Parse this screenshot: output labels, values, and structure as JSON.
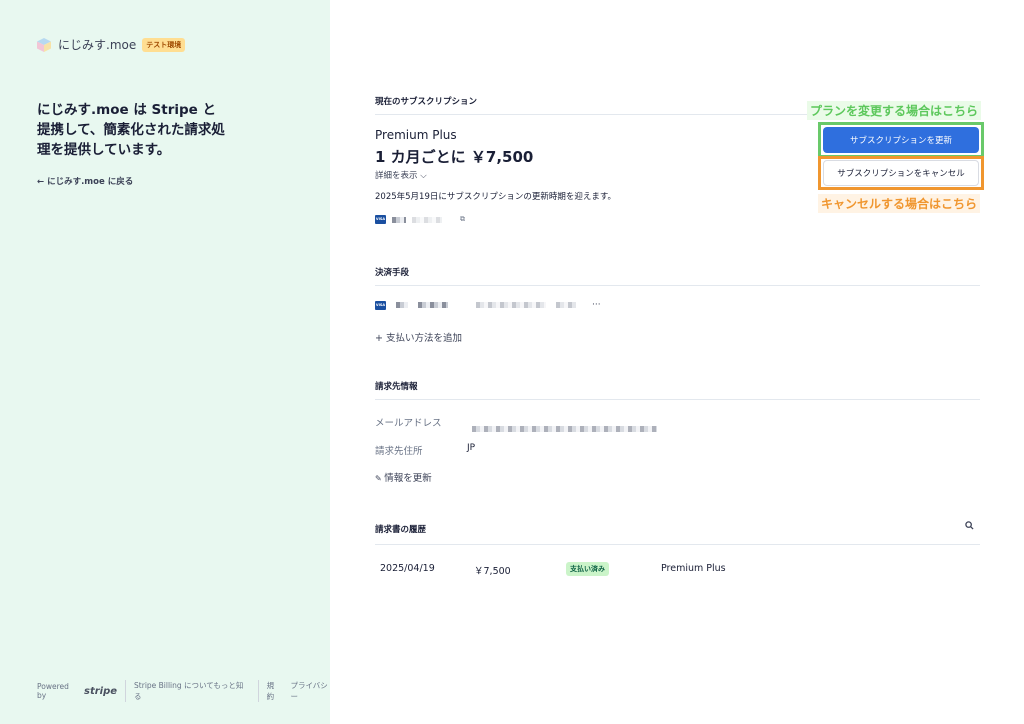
{
  "left_panel": {
    "brand": "にじみす.moe",
    "test_badge": "テスト環境",
    "tagline": "にじみす.moe は Stripe と提携して、簡素化された請求処理を提供しています。",
    "back_link": "← にじみす.moe に戻る",
    "footer": {
      "powered_by": "Powered by",
      "stripe": "stripe",
      "billing_link": "Stripe Billing についてもっと知る",
      "terms": "規約",
      "privacy": "プライバシー"
    }
  },
  "subscription": {
    "section_title": "現在のサブスクリプション",
    "plan_name": "Premium Plus",
    "price": "1 カ月ごとに ￥7,500",
    "details_toggle": "詳細を表示 ⌵",
    "renewal_text": "2025年5月19日にサブスクリプションの更新時期を迎えます。",
    "update_button": "サブスクリプションを更新",
    "cancel_button": "サブスクリプションをキャンセル"
  },
  "annotations": {
    "change_plan": "プランを変更する場合はこちら",
    "cancel_plan": "キャンセルする場合はこちら"
  },
  "payment": {
    "section_title": "決済手段",
    "card_brand": "VISA",
    "more": "···",
    "add_method": "+ 支払い方法を追加"
  },
  "billing": {
    "section_title": "請求先情報",
    "email_label": "メールアドレス",
    "address_label": "請求先住所",
    "address_value": "JP",
    "update_info": "情報を更新"
  },
  "invoices": {
    "section_title": "請求書の履歴",
    "rows": [
      {
        "date": "2025/04/19",
        "amount": "￥7,500",
        "status": "支払い済み",
        "plan": "Premium Plus"
      }
    ]
  },
  "colors": {
    "left_bg": "#e8f8f0",
    "primary": "#2f6fde",
    "annotation_green": "#69c96a",
    "annotation_orange": "#f0962f"
  },
  "icons": {
    "logo": "cube-logo-icon",
    "external": "external-link-icon",
    "edit": "edit-icon",
    "search": "search-icon"
  }
}
